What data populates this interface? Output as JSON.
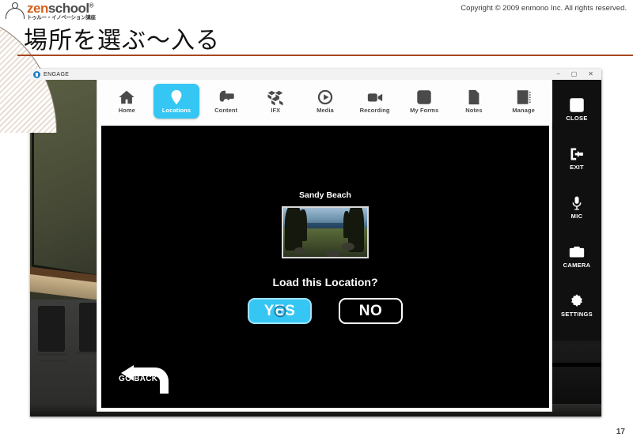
{
  "slide": {
    "title": "場所を選ぶ〜入る",
    "copyright": "Copyright © 2009 enmono Inc. All rights reserved.",
    "page_number": "17",
    "logo": {
      "word_first": "zen",
      "word_second": "school",
      "registered": "®",
      "subtitle": "トゥルー・イノベーション講座"
    },
    "accent_color": "#a8461f"
  },
  "window": {
    "title": "ENGAGE",
    "icon": "engage-app-icon",
    "controls": {
      "minimize": "−",
      "maximize": "▢",
      "close": "✕"
    }
  },
  "nav": {
    "items": [
      {
        "label": "Home",
        "icon": "home-icon",
        "active": false
      },
      {
        "label": "Locations",
        "icon": "map-pin-icon",
        "active": true
      },
      {
        "label": "Content",
        "icon": "vr-headset-icon",
        "active": false
      },
      {
        "label": "IFX",
        "icon": "blocks-icon",
        "active": false
      },
      {
        "label": "Media",
        "icon": "play-circle-icon",
        "active": false
      },
      {
        "label": "Recording",
        "icon": "video-camera-icon",
        "active": false
      },
      {
        "label": "My Forms",
        "icon": "checkmark-icon",
        "active": false
      },
      {
        "label": "Notes",
        "icon": "document-icon",
        "active": false
      },
      {
        "label": "Manage",
        "icon": "contact-card-icon",
        "active": false
      }
    ],
    "active_color": "#35c6f4"
  },
  "stage": {
    "location_name": "Sandy Beach",
    "thumbnail_alt": "sandy-beach-preview",
    "prompt": "Load this Location?",
    "yes_label": "YES",
    "no_label": "NO",
    "go_back_label": "GO BACK",
    "cursor": "ring-cursor"
  },
  "rail": {
    "items": [
      {
        "label": "CLOSE",
        "icon": "close-box-icon"
      },
      {
        "label": "EXIT",
        "icon": "exit-arrow-icon"
      },
      {
        "label": "MIC",
        "icon": "microphone-icon"
      },
      {
        "label": "CAMERA",
        "icon": "camera-icon"
      },
      {
        "label": "SETTINGS",
        "icon": "gear-icon"
      }
    ]
  }
}
